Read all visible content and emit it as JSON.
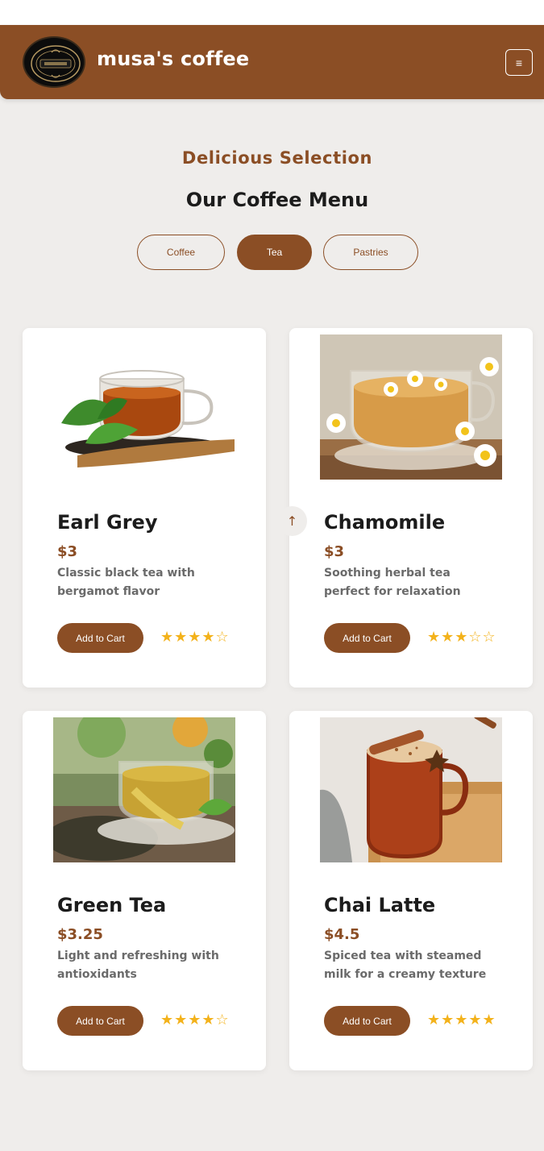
{
  "header": {
    "brand": "musa's coffee",
    "logo_icon": "coffee-logo-icon",
    "menu_icon": "hamburger-icon",
    "menu_glyph": "≡"
  },
  "section": {
    "subtitle": "Delicious Selection",
    "title": "Our Coffee Menu"
  },
  "tabs": [
    {
      "label": "Coffee",
      "active": false
    },
    {
      "label": "Tea",
      "active": true
    },
    {
      "label": "Pastries",
      "active": false
    }
  ],
  "items": [
    {
      "name": "Earl Grey",
      "price": "$3",
      "description": "Classic black tea with bergamot flavor",
      "cart_label": "Add to Cart",
      "stars": "★★★★☆",
      "rating": 4
    },
    {
      "name": "Chamomile",
      "price": "$3",
      "description": "Soothing herbal tea perfect for relaxation",
      "cart_label": "Add to Cart",
      "stars": "★★★☆☆",
      "rating": 3
    },
    {
      "name": "Green Tea",
      "price": "$3.25",
      "description": "Light and refreshing with antioxidants",
      "cart_label": "Add to Cart",
      "stars": "★★★★☆",
      "rating": 4
    },
    {
      "name": "Chai Latte",
      "price": "$4.5",
      "description": "Spiced tea with steamed milk for a creamy texture",
      "cart_label": "Add to Cart",
      "stars": "★★★★★",
      "rating": 5
    }
  ],
  "scroll_top": {
    "icon": "arrow-up-icon",
    "glyph": "↑"
  },
  "colors": {
    "brand": "#8b4e25",
    "star": "#f3b21b",
    "background": "#efedeb"
  }
}
